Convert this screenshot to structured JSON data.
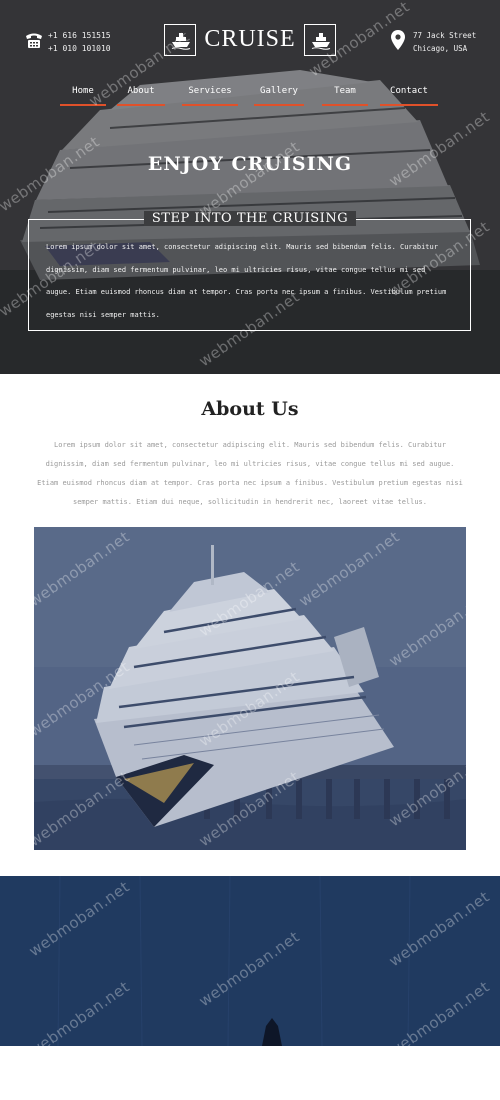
{
  "header": {
    "phones": [
      "+1 616 151515",
      "+1 010 101010"
    ],
    "logo_text": "CRUISE",
    "address": [
      "77 Jack Street",
      "Chicago, USA"
    ]
  },
  "nav": {
    "items": [
      {
        "label": "Home"
      },
      {
        "label": "About"
      },
      {
        "label": "Services"
      },
      {
        "label": "Gallery"
      },
      {
        "label": "Team"
      },
      {
        "label": "Contact"
      }
    ],
    "accent": "#e0512a"
  },
  "hero": {
    "title": "ENJOY CRUISING",
    "box_title": "STEP INTO THE CRUISING",
    "box_text": "Lorem ipsum dolor sit amet, consectetur adipiscing elit. Mauris sed bibendum felis. Curabitur dignissim, diam sed fermentum pulvinar, leo mi ultricies risus, vitae congue tellus mi sed augue. Etiam euismod rhoncus diam at tempor. Cras porta nec ipsum a finibus. Vestibulum pretium egestas nisi semper mattis."
  },
  "about": {
    "title": "About Us",
    "text": "Lorem ipsum dolor sit amet, consectetur adipiscing elit. Mauris sed bibendum felis. Curabitur dignissim, diam sed fermentum pulvinar, leo mi ultricies risus, vitae congue tellus mi sed augue. Etiam euismod rhoncus diam at tempor. Cras porta nec ipsum a finibus. Vestibulum pretium egestas nisi semper mattis. Etiam dui neque, sollicitudin in hendrerit nec, laoreet vitae tellus."
  },
  "watermark": "webmoban.net",
  "icons": [
    "phone-icon",
    "ship-icon",
    "map-pin-icon"
  ]
}
